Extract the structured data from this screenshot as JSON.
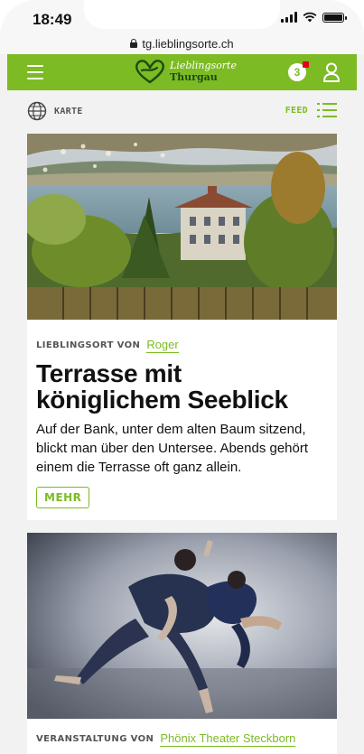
{
  "status_bar": {
    "time": "18:49"
  },
  "browser": {
    "url": "tg.lieblingsorte.ch"
  },
  "header": {
    "logo_line1": "Lieblingsorte",
    "logo_line2": "Thurgau",
    "notification_count": "3",
    "accent_color": "#7cbb23"
  },
  "view_bar": {
    "map_label": "KARTE",
    "feed_label": "FEED"
  },
  "feed": [
    {
      "meta_label": "LIEBLINGSORT VON",
      "author": "Roger",
      "title": "Terrasse mit königlichem Seeblick",
      "text": "Auf der Bank, unter dem alten Baum sitzend, blickt man über den Untersee. Abends gehört einem die Terrasse oft ganz allein.",
      "button_label": "MEHR"
    },
    {
      "meta_label": "VERANSTALTUNG VON",
      "author": "Phönix Theater Steckborn"
    }
  ]
}
